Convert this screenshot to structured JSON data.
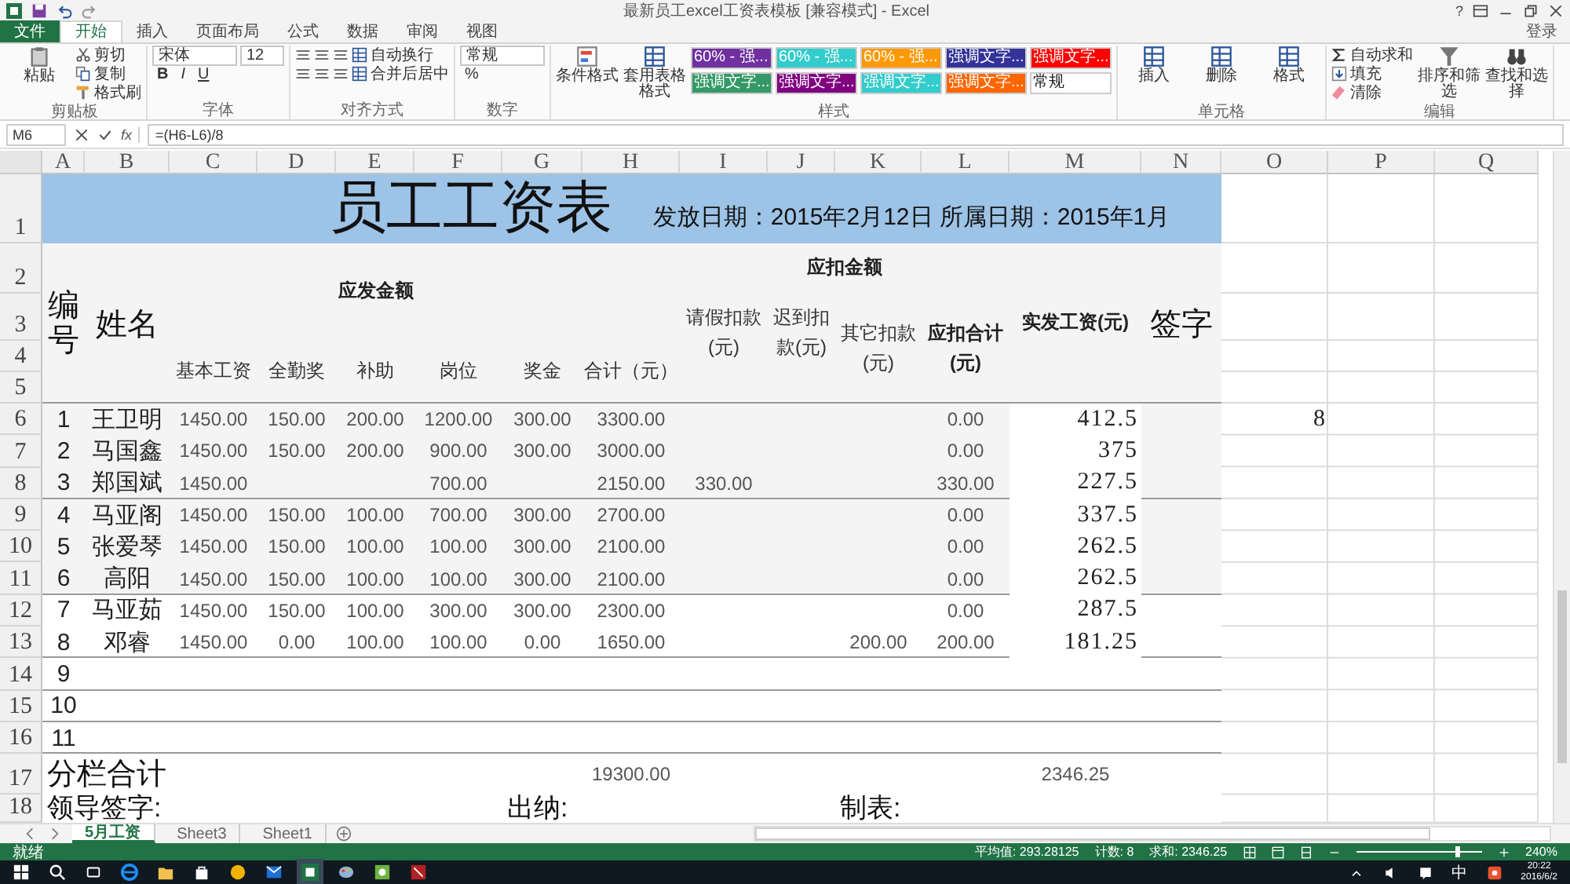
{
  "window": {
    "title": "最新员工excel工资表模板 [兼容模式] - Excel",
    "help": "?",
    "account": "登录"
  },
  "ribbon": {
    "tabs": [
      {
        "label": "文件",
        "kind": "file",
        "selected": false
      },
      {
        "label": "开始",
        "kind": "tab",
        "selected": true
      },
      {
        "label": "插入",
        "kind": "tab",
        "selected": false
      },
      {
        "label": "页面布局",
        "kind": "tab",
        "selected": false
      },
      {
        "label": "公式",
        "kind": "tab",
        "selected": false
      },
      {
        "label": "数据",
        "kind": "tab",
        "selected": false
      },
      {
        "label": "审阅",
        "kind": "tab",
        "selected": false
      },
      {
        "label": "视图",
        "kind": "tab",
        "selected": false
      }
    ],
    "groups": [
      {
        "label": "剪贴板",
        "stacks": [
          [
            [
              {
                "kind": "paste",
                "label": "粘贴"
              }
            ]
          ],
          [
            [
              {
                "kind": "cut",
                "label": "剪切"
              }
            ],
            [
              {
                "kind": "copy",
                "label": "复制"
              }
            ],
            [
              {
                "kind": "painter",
                "label": "格式刷"
              }
            ]
          ]
        ]
      },
      {
        "label": "字体",
        "stacks": [
          [
            [
              {
                "kind": "field",
                "label": "宋体"
              },
              {
                "kind": "field",
                "label": "12"
              }
            ],
            [
              {
                "kind": "bold",
                "label": "B"
              },
              {
                "kind": "italic",
                "label": "I"
              },
              {
                "kind": "underline",
                "label": "U"
              }
            ]
          ]
        ]
      },
      {
        "label": "对齐方式",
        "stacks": [
          [
            [
              {
                "kind": "align"
              },
              {
                "kind": "align"
              },
              {
                "kind": "align"
              },
              {
                "kind": "wrap",
                "label": "自动换行"
              }
            ],
            [
              {
                "kind": "align"
              },
              {
                "kind": "align"
              },
              {
                "kind": "align"
              },
              {
                "kind": "merge",
                "label": "合并后居中"
              }
            ]
          ]
        ]
      },
      {
        "label": "数字",
        "stacks": [
          [
            [
              {
                "kind": "field",
                "label": "常规"
              }
            ],
            [
              {
                "kind": "percent",
                "label": "%"
              }
            ]
          ]
        ]
      },
      {
        "label": "样式",
        "stacks": [
          [
            [
              {
                "kind": "conditional",
                "label": "条件格式"
              }
            ]
          ],
          [
            [
              {
                "kind": "table-format",
                "label": "套用表格格式"
              }
            ]
          ],
          [
            [
              {
                "kind": "style",
                "label": "60% - 强...",
                "color": "#7030a0"
              },
              {
                "kind": "style",
                "label": "60% - 强...",
                "color": "#33cccc"
              },
              {
                "kind": "style",
                "label": "60% - 强...",
                "color": "#ff9900"
              },
              {
                "kind": "style",
                "label": "强调文字...",
                "color": "#333399"
              },
              {
                "kind": "style",
                "label": "强调文字...",
                "color": "#ff0000"
              }
            ],
            [
              {
                "kind": "style",
                "label": "强调文字...",
                "color": "#339966"
              },
              {
                "kind": "style",
                "label": "强调文字...",
                "color": "#800080"
              },
              {
                "kind": "style",
                "label": "强调文字...",
                "color": "#33cccc"
              },
              {
                "kind": "style",
                "label": "强调文字...",
                "color": "#ff6600"
              },
              {
                "kind": "style",
                "label": "常规",
                "color": "#ffffff"
              }
            ]
          ]
        ]
      },
      {
        "label": "单元格",
        "stacks": [
          [
            [
              {
                "kind": "insert",
                "label": "插入"
              }
            ]
          ],
          [
            [
              {
                "kind": "delete",
                "label": "删除"
              }
            ]
          ],
          [
            [
              {
                "kind": "format",
                "label": "格式"
              }
            ]
          ]
        ]
      },
      {
        "label": "编辑",
        "stacks": [
          [
            [
              {
                "kind": "autosum",
                "label": "自动求和"
              }
            ],
            [
              {
                "kind": "fill",
                "label": "填充"
              }
            ],
            [
              {
                "kind": "clear",
                "label": "清除"
              }
            ]
          ],
          [
            [
              {
                "kind": "sort",
                "label": "排序和筛选"
              }
            ]
          ],
          [
            [
              {
                "kind": "find",
                "label": "查找和选择"
              }
            ]
          ]
        ]
      }
    ]
  },
  "formula_bar": {
    "name_box": "M6",
    "fx": "fx",
    "formula": "=(H6-L6)/8"
  },
  "sheet": {
    "columns": [
      "A",
      "B",
      "C",
      "D",
      "E",
      "F",
      "G",
      "H",
      "I",
      "J",
      "K",
      "L",
      "M",
      "N",
      "O",
      "P",
      "Q"
    ],
    "row_numbers": [
      "1",
      "2",
      "3",
      "4",
      "5",
      "6",
      "7",
      "8",
      "9",
      "10",
      "11",
      "12",
      "13",
      "14",
      "15",
      "16",
      "17",
      "18"
    ],
    "title": "员工工资表",
    "subtitle": "发放日期：2015年2月12日 所属日期：2015年1月",
    "headings": [
      "编号",
      "姓名",
      "应发金额",
      "应扣金额",
      "请假扣款(元)",
      "迟到扣款(元)",
      "其它扣款(元)",
      "应扣合计(元)",
      "实发工资(元)",
      "签字",
      "基本工资",
      "全勤奖",
      "补助",
      "岗位",
      "奖金",
      "合计（元）"
    ],
    "rows": [
      {
        "rule_below": false,
        "cells": [
          "1",
          "王卫明",
          "1450.00",
          "150.00",
          "200.00",
          "1200.00",
          "300.00",
          "3300.00",
          "",
          "",
          "",
          "0.00",
          "412.5",
          "",
          "8"
        ]
      },
      {
        "rule_below": false,
        "cells": [
          "2",
          "马国鑫",
          "1450.00",
          "150.00",
          "200.00",
          "900.00",
          "300.00",
          "3000.00",
          "",
          "",
          "",
          "0.00",
          "375"
        ]
      },
      {
        "rule_below": true,
        "cells": [
          "3",
          "郑国斌",
          "1450.00",
          "",
          "",
          "700.00",
          "",
          "2150.00",
          "330.00",
          "",
          "",
          "330.00",
          "227.5"
        ]
      },
      {
        "rule_below": false,
        "cells": [
          "4",
          "马亚阁",
          "1450.00",
          "150.00",
          "100.00",
          "700.00",
          "300.00",
          "2700.00",
          "",
          "",
          "",
          "0.00",
          "337.5"
        ]
      },
      {
        "rule_below": false,
        "cells": [
          "5",
          "张爱琴",
          "1450.00",
          "150.00",
          "100.00",
          "100.00",
          "300.00",
          "2100.00",
          "",
          "",
          "",
          "0.00",
          "262.5"
        ]
      },
      {
        "rule_below": true,
        "cells": [
          "6",
          "高阳",
          "1450.00",
          "150.00",
          "100.00",
          "100.00",
          "300.00",
          "2100.00",
          "",
          "",
          "",
          "0.00",
          "262.5"
        ]
      },
      {
        "rule_below": false,
        "cells": [
          "7",
          "马亚茹",
          "1450.00",
          "150.00",
          "100.00",
          "300.00",
          "300.00",
          "2300.00",
          "",
          "",
          "",
          "0.00",
          "287.5"
        ]
      },
      {
        "rule_below": true,
        "cells": [
          "8",
          "邓睿",
          "1450.00",
          "0.00",
          "100.00",
          "100.00",
          "0.00",
          "1650.00",
          "",
          "",
          "200.00",
          "200.00",
          "181.25"
        ]
      },
      {
        "rule_below": true,
        "cells": [
          "9"
        ]
      },
      {
        "rule_below": true,
        "cells": [
          "10"
        ]
      },
      {
        "rule_below": true,
        "cells": [
          "11"
        ]
      }
    ],
    "total": {
      "label": "分栏合计",
      "gross": "19300.00",
      "net": "2346.25"
    },
    "signatures": [
      "领导签字:",
      "出纳:",
      "制表:"
    ]
  },
  "sheet_tabs": [
    {
      "label": "5月工资",
      "selected": true
    },
    {
      "label": "Sheet3",
      "selected": false
    },
    {
      "label": "Sheet1",
      "selected": false
    }
  ],
  "status_bar": {
    "state": "就绪",
    "average": "平均值: 293.28125",
    "count": "计数: 8",
    "sum": "求和: 2346.25",
    "zoom": {
      "level": 0.8,
      "reading": "240%"
    }
  },
  "taskbar": {
    "ime": "中",
    "time": "20:22",
    "date": "2016/6/2"
  }
}
